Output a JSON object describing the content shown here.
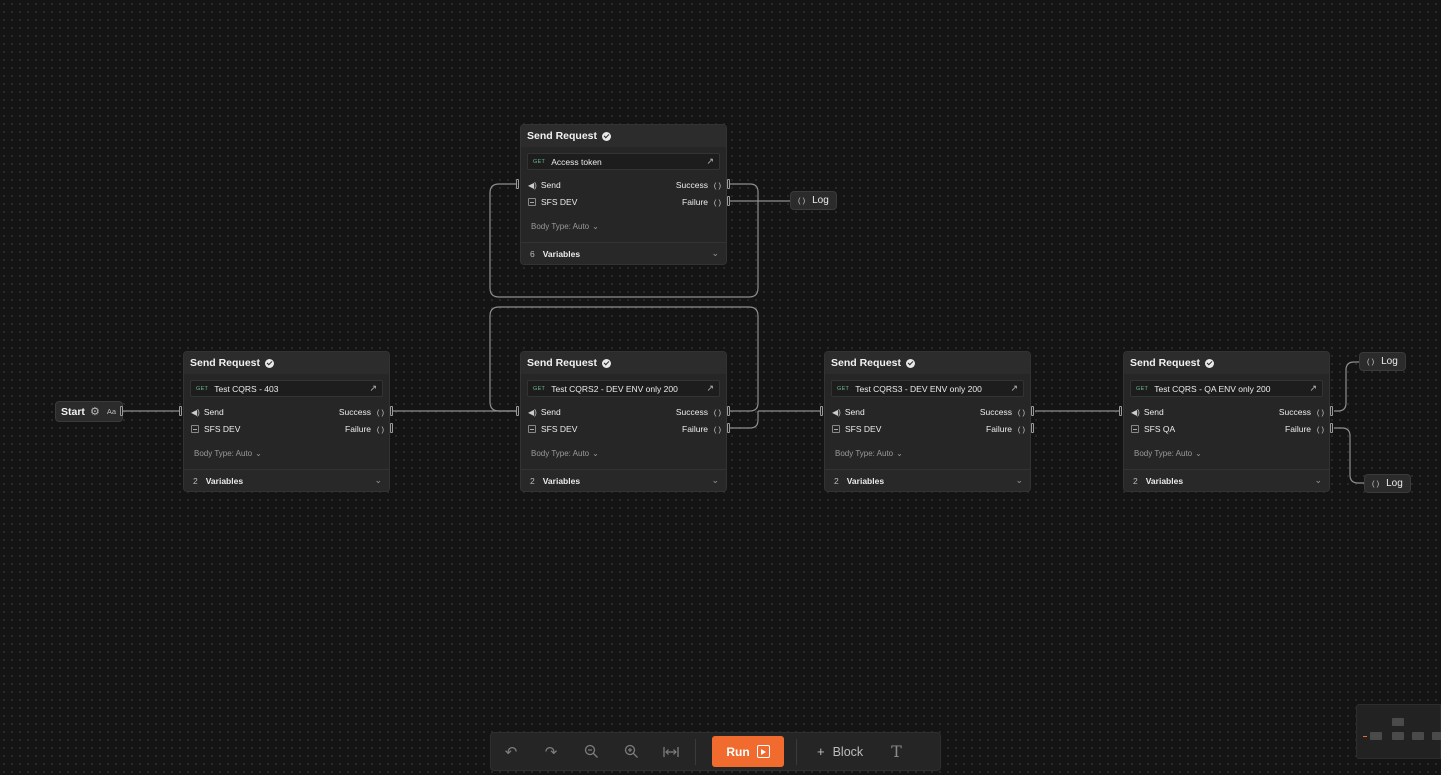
{
  "start": {
    "label": "Start",
    "badge": "Aa",
    "icon": "gear-icon"
  },
  "nodes": [
    {
      "title": "Send Request",
      "method": "GET",
      "request": "Access token",
      "send": "Send",
      "env": "SFS DEV",
      "success": "Success",
      "failure": "Failure",
      "body_type": "Body Type: Auto",
      "var_count": "6",
      "vars_label": "Variables"
    },
    {
      "title": "Send Request",
      "method": "GET",
      "request": "Test CQRS - 403",
      "send": "Send",
      "env": "SFS DEV",
      "success": "Success",
      "failure": "Failure",
      "body_type": "Body Type: Auto",
      "var_count": "2",
      "vars_label": "Variables"
    },
    {
      "title": "Send Request",
      "method": "GET",
      "request": "Test CQRS2 - DEV ENV only 200",
      "send": "Send",
      "env": "SFS DEV",
      "success": "Success",
      "failure": "Failure",
      "body_type": "Body Type: Auto",
      "var_count": "2",
      "vars_label": "Variables"
    },
    {
      "title": "Send Request",
      "method": "GET",
      "request": "Test CQRS3 - DEV ENV only 200",
      "send": "Send",
      "env": "SFS DEV",
      "success": "Success",
      "failure": "Failure",
      "body_type": "Body Type: Auto",
      "var_count": "2",
      "vars_label": "Variables"
    },
    {
      "title": "Send Request",
      "method": "GET",
      "request": "Test CQRS - QA ENV only 200",
      "send": "Send",
      "env": "SFS QA",
      "success": "Success",
      "failure": "Failure",
      "body_type": "Body Type: Auto",
      "var_count": "2",
      "vars_label": "Variables"
    }
  ],
  "logs": [
    {
      "label": "Log"
    },
    {
      "label": "Log"
    },
    {
      "label": "Log"
    }
  ],
  "toolbar": {
    "undo_icon": "undo-icon",
    "redo_icon": "redo-icon",
    "zoom_out_icon": "zoom-out-icon",
    "zoom_in_icon": "zoom-in-icon",
    "fit_icon": "fit-width-icon",
    "run_label": "Run",
    "block_label": "Block",
    "text_icon": "text-icon"
  },
  "colors": {
    "accent": "#f26b2e",
    "canvas": "#141414",
    "node": "#262626",
    "method": "#6fb58f",
    "wire": "#8e8e8e"
  }
}
